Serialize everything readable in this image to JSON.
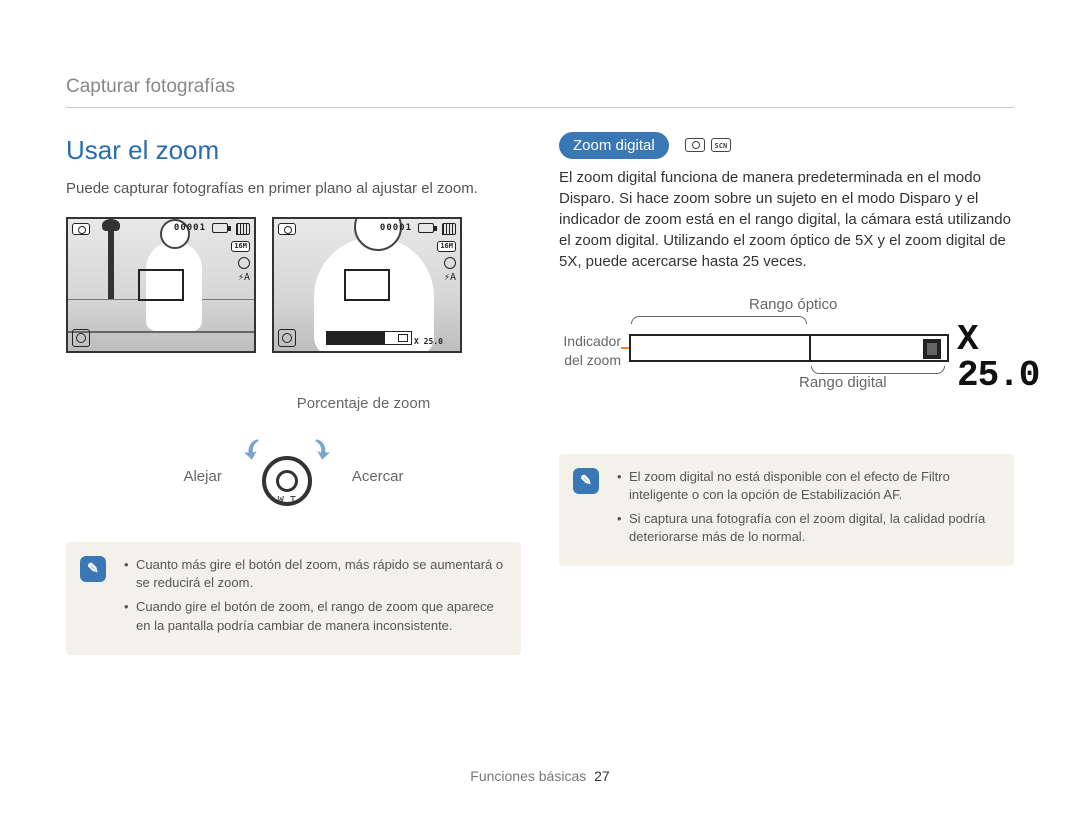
{
  "breadcrumb": "Capturar fotografías",
  "left": {
    "title": "Usar el zoom",
    "intro": "Puede capturar fotografías en primer plano al ajustar el zoom.",
    "screen_counter": "00001",
    "screen_size_badge": "16M",
    "screen_flash": "⚡A",
    "zoom_percentage_label": "Porcentaje de zoom",
    "zoom_indicator_text": "X 25.0",
    "dial_left": "Alejar",
    "dial_right": "Acercar",
    "dial_wt": "W    T",
    "note1": "Cuanto más gire el botón del zoom, más rápido se aumentará o se reducirá el zoom.",
    "note2": "Cuando gire el botón de zoom, el rango de zoom que aparece en la pantalla podría cambiar de manera inconsistente."
  },
  "right": {
    "pill": "Zoom digital",
    "scn_text": "SCN",
    "body": "El zoom digital funciona de manera predeterminada en el modo Disparo. Si hace zoom sobre un sujeto en el modo Disparo y el indicador de zoom está en el rango digital, la cámara está utilizando el zoom digital. Utilizando el zoom óptico de 5X y el zoom digital de 5X, puede acercarse hasta 25 veces.",
    "range_optical": "Rango óptico",
    "indicator_label": "Indicador del zoom",
    "range_digital": "Rango digital",
    "range_value": "X 25.0",
    "note1": "El zoom digital no está disponible con el efecto de Filtro inteligente o con la opción de Estabilización AF.",
    "note2": "Si captura una fotografía con el zoom digital, la calidad podría deteriorarse más de lo normal."
  },
  "footer": {
    "section": "Funciones básicas",
    "page": "27"
  },
  "note_icon_glyph": "✎"
}
